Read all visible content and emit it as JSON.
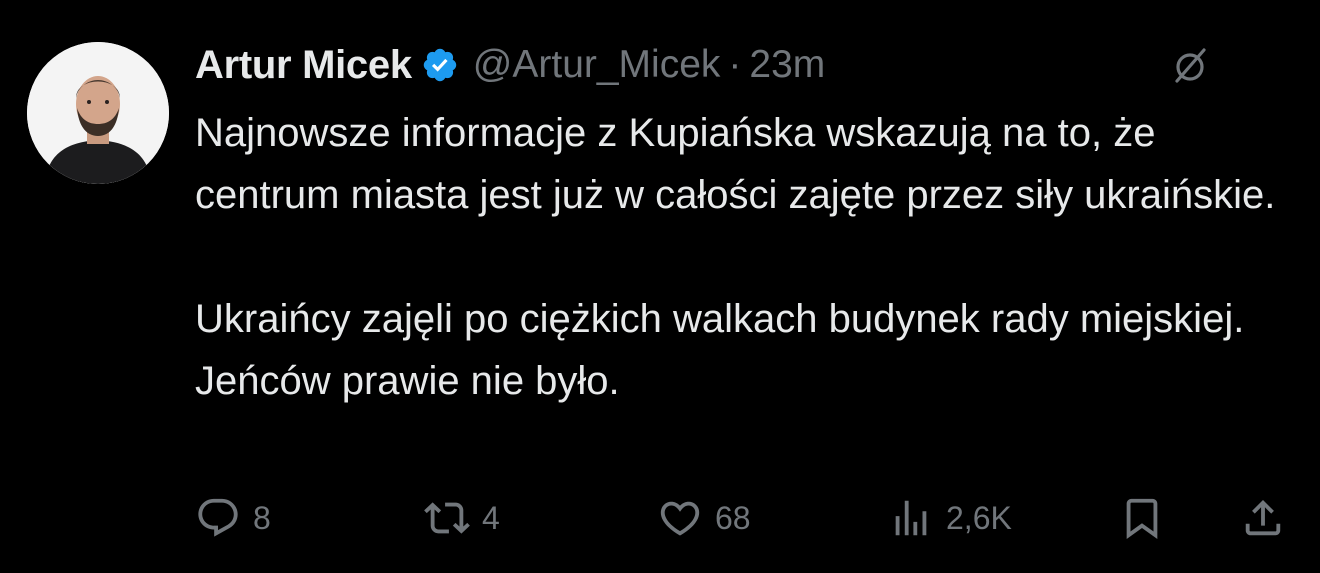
{
  "tweet": {
    "author": {
      "display_name": "Artur Micek",
      "handle": "@Artur_Micek",
      "verified": true,
      "avatar_icon": "person-photo-avatar"
    },
    "separator": "·",
    "time": "23m",
    "grok_icon": "slashed-circle-icon",
    "paragraphs": [
      "Najnowsze informacje z Kupiańska wskazują na to, że centrum miasta jest już w całości zajęte przez siły ukraińskie.",
      "Ukraińcy zajęli po ciężkich walkach budynek rady miejskiej. Jeńców prawie nie było."
    ],
    "actions": {
      "replies": "8",
      "reposts": "4",
      "likes": "68",
      "views": "2,6K"
    }
  },
  "colors": {
    "background": "#000000",
    "text": "#e7e9ea",
    "muted": "#71767b",
    "verified_badge": "#1d9bf0"
  }
}
